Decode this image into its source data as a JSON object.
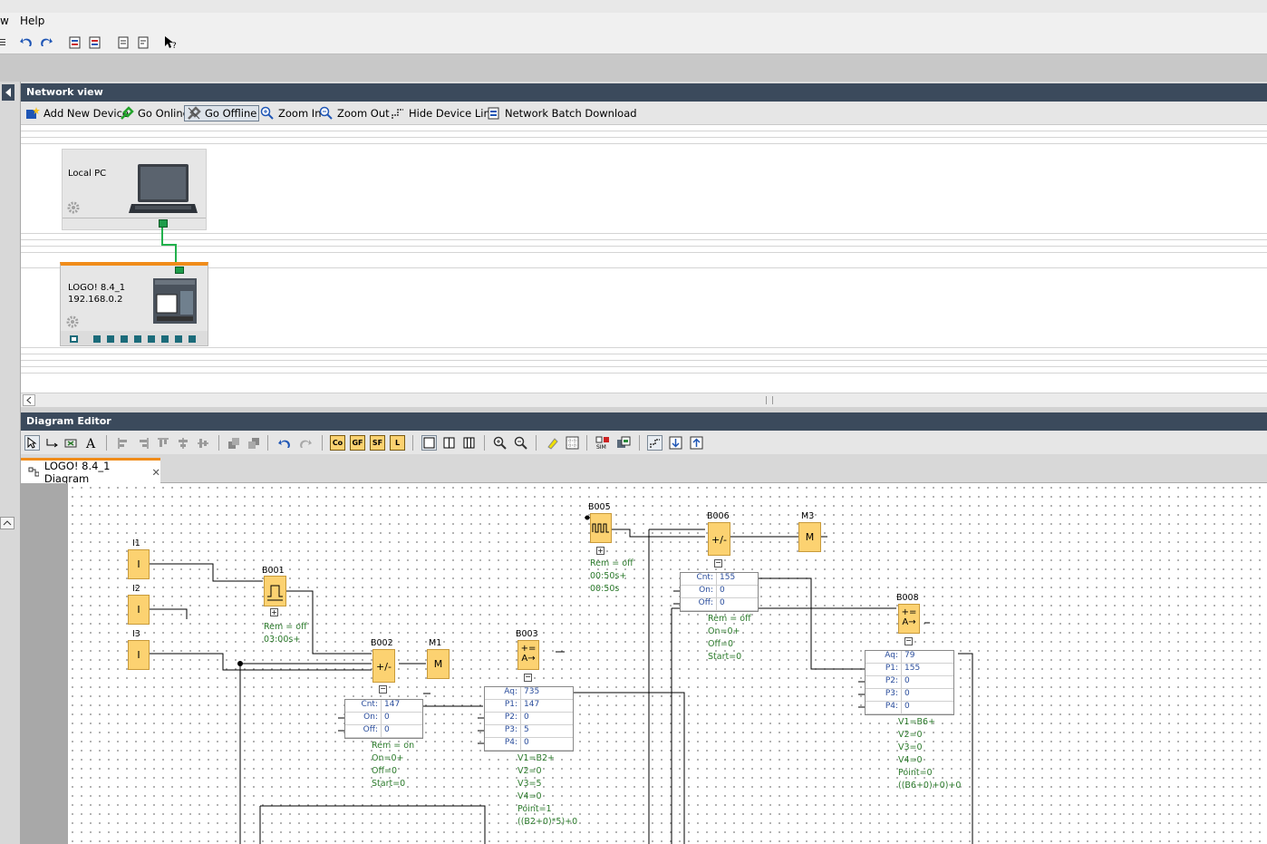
{
  "menubar": {
    "item_view_fragment": "w",
    "item_help": "Help"
  },
  "network_view": {
    "title": "Network view",
    "toolbar": {
      "add_new_device": "Add New Device",
      "go_online": "Go Online",
      "go_offline": "Go Offline",
      "zoom_in": "Zoom In",
      "zoom_out": "Zoom Out",
      "hide_device_line": "Hide Device Line",
      "network_batch_download": "Network Batch Download"
    },
    "devices": [
      {
        "name": "Local PC"
      },
      {
        "name": "LOGO! 8.4_1",
        "ip": "192.168.0.2"
      }
    ]
  },
  "diagram_editor": {
    "title": "Diagram Editor",
    "toolbar": {
      "co": "Co",
      "gf": "GF",
      "sf": "SF",
      "l": "L"
    },
    "tab_label": "LOGO! 8.4_1 Diagram",
    "blocks": {
      "i1": {
        "id": "I1",
        "symbol": "I"
      },
      "i2": {
        "id": "I2",
        "symbol": "I"
      },
      "i3": {
        "id": "I3",
        "symbol": "I"
      },
      "b001": {
        "id": "B001",
        "params": [
          "Rem = off",
          "03:00s+"
        ]
      },
      "b002": {
        "id": "B002",
        "symbol": "+/-",
        "table": [
          {
            "k": "Cnt:",
            "v": "147"
          },
          {
            "k": "On:",
            "v": "0"
          },
          {
            "k": "Off:",
            "v": "0"
          }
        ],
        "params": [
          "Rem = on",
          "On=0+",
          "Off=0",
          "Start=0"
        ]
      },
      "m1": {
        "id": "M1",
        "symbol": "M"
      },
      "b003": {
        "id": "B003",
        "symbol": "+= A→",
        "table": [
          {
            "k": "Aq:",
            "v": "735"
          },
          {
            "k": "P1:",
            "v": "147"
          },
          {
            "k": "P2:",
            "v": "0"
          },
          {
            "k": "P3:",
            "v": "5"
          },
          {
            "k": "P4:",
            "v": "0"
          }
        ],
        "params": [
          "V1=B2+",
          "V2=0",
          "V3=5",
          "V4=0",
          "Point=1",
          "((B2+0)*5)+0"
        ]
      },
      "b005": {
        "id": "B005",
        "params": [
          "Rem = off",
          "00:50s+",
          "00:50s"
        ]
      },
      "b006": {
        "id": "B006",
        "symbol": "+/-",
        "table": [
          {
            "k": "Cnt:",
            "v": "155"
          },
          {
            "k": "On:",
            "v": "0"
          },
          {
            "k": "Off:",
            "v": "0"
          }
        ],
        "params": [
          "Rem = off",
          "On=0+",
          "Off=0",
          "Start=0"
        ]
      },
      "m3": {
        "id": "M3",
        "symbol": "M"
      },
      "b008": {
        "id": "B008",
        "symbol": "+= A→",
        "table": [
          {
            "k": "Aq:",
            "v": "79"
          },
          {
            "k": "P1:",
            "v": "155"
          },
          {
            "k": "P2:",
            "v": "0"
          },
          {
            "k": "P3:",
            "v": "0"
          },
          {
            "k": "P4:",
            "v": "0"
          }
        ],
        "params": [
          "V1=B6+",
          "V2=0",
          "V3=0",
          "V4=0",
          "Point=0",
          "((B6+0)+0)+0"
        ]
      }
    }
  },
  "colors": {
    "panel_header": "#3b4a5c",
    "block_fill": "#fcd271",
    "accent_orange": "#f08c1a",
    "param_green": "#2b7a2b",
    "param_blue": "#2a4d9c",
    "link_green": "#22b14c"
  }
}
